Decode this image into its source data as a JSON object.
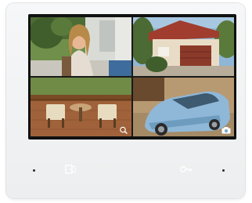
{
  "device": {
    "bezel_color": "#f2f3f4",
    "screen_border_color": "#111111"
  },
  "cameras": [
    {
      "feed": "woman-at-door",
      "icon": "none"
    },
    {
      "feed": "house-with-garage",
      "icon": "none"
    },
    {
      "feed": "patio-furniture",
      "icon": "zoom-icon"
    },
    {
      "feed": "car-in-driveway",
      "icon": "camera-icon"
    }
  ],
  "buttons": {
    "left": "door-open-icon",
    "right": "key-icon"
  }
}
